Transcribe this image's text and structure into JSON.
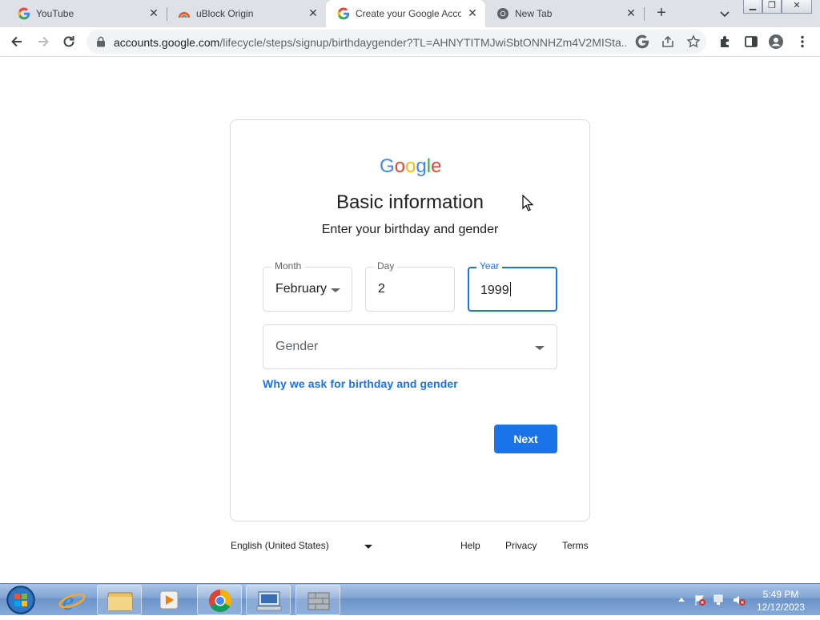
{
  "tabs": [
    {
      "title": "YouTube",
      "favicon": "google-g-icon",
      "active": false
    },
    {
      "title": "uBlock Origin",
      "favicon": "ublock-rainbow-icon",
      "active": false
    },
    {
      "title": "Create your Google Acco",
      "favicon": "google-g-icon",
      "active": true
    },
    {
      "title": "New Tab",
      "favicon": "chrome-icon",
      "active": false
    }
  ],
  "toolbar": {
    "url_host": "accounts.google.com",
    "url_path": "/lifecycle/steps/signup/birthdaygender?TL=AHNYTITMJwiSbtONNHZm4V2MISta..."
  },
  "page": {
    "heading": "Basic information",
    "subheading": "Enter your birthday and gender",
    "month_label": "Month",
    "month_value": "February",
    "day_label": "Day",
    "day_value": "2",
    "year_label": "Year",
    "year_value": "1999",
    "gender_placeholder": "Gender",
    "why_link": "Why we ask for birthday and gender",
    "next_button": "Next"
  },
  "footer": {
    "language": "English (United States)",
    "help": "Help",
    "privacy": "Privacy",
    "terms": "Terms"
  },
  "taskbar": {
    "time": "5:49 PM",
    "date": "12/12/2023"
  },
  "colors": {
    "accent": "#1a73e8",
    "tabstrip": "#dee1e6",
    "border": "#dadce0"
  }
}
